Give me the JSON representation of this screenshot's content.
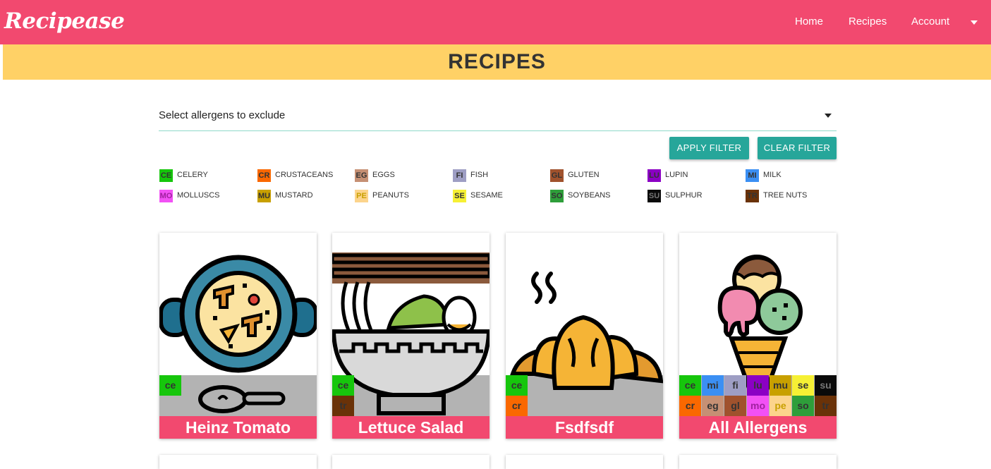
{
  "nav": {
    "brand": "Recipease",
    "links": [
      "Home",
      "Recipes",
      "Account"
    ]
  },
  "banner": {
    "title": "RECIPES"
  },
  "filter": {
    "select_text": "Select allergens to exclude",
    "apply_label": "APPLY FILTER",
    "clear_label": "CLEAR FILTER"
  },
  "legend": [
    {
      "code": "CE",
      "name": "CELERY",
      "color": "#16c60c"
    },
    {
      "code": "CR",
      "name": "CRUSTACEANS",
      "color": "#fa6800"
    },
    {
      "code": "EG",
      "name": "EGGS",
      "color": "#c69074"
    },
    {
      "code": "FI",
      "name": "FISH",
      "color": "#9e9ec4"
    },
    {
      "code": "GL",
      "name": "GLUTEN",
      "color": "#a0522d"
    },
    {
      "code": "LU",
      "name": "LUPIN",
      "color": "#8b00c4"
    },
    {
      "code": "MI",
      "name": "MILK",
      "color": "#3b8ff3"
    },
    {
      "code": "MO",
      "name": "MOLLUSCS",
      "color": "#f251f5"
    },
    {
      "code": "MU",
      "name": "MUSTARD",
      "color": "#c8a000"
    },
    {
      "code": "PE",
      "name": "PEANUTS",
      "color": "#fcd48c"
    },
    {
      "code": "SE",
      "name": "SESAME",
      "color": "#f6f034"
    },
    {
      "code": "SO",
      "name": "SOYBEANS",
      "color": "#2e9e3a"
    },
    {
      "code": "SU",
      "name": "SULPHUR",
      "color": "#0a0a0a"
    },
    {
      "code": "TR",
      "name": "TREE NUTS",
      "color": "#6a3208"
    }
  ],
  "recipes": [
    {
      "title": "Heinz Tomato",
      "image": "paella-pan-icon",
      "tags": [
        "ce"
      ]
    },
    {
      "title": "Lettuce Salad",
      "image": "noodle-bowl-icon",
      "tags": [
        "ce",
        "tr"
      ]
    },
    {
      "title": "Fsdfsdf",
      "image": "croissant-icon",
      "tags": [
        "ce",
        "cr"
      ]
    },
    {
      "title": "All Allergens",
      "image": "ice-cream-icon",
      "tags": [
        "ce",
        "mi",
        "fi",
        "lu",
        "mu",
        "se",
        "su",
        "cr",
        "eg",
        "gl",
        "mo",
        "pe",
        "so",
        "tr"
      ]
    }
  ]
}
